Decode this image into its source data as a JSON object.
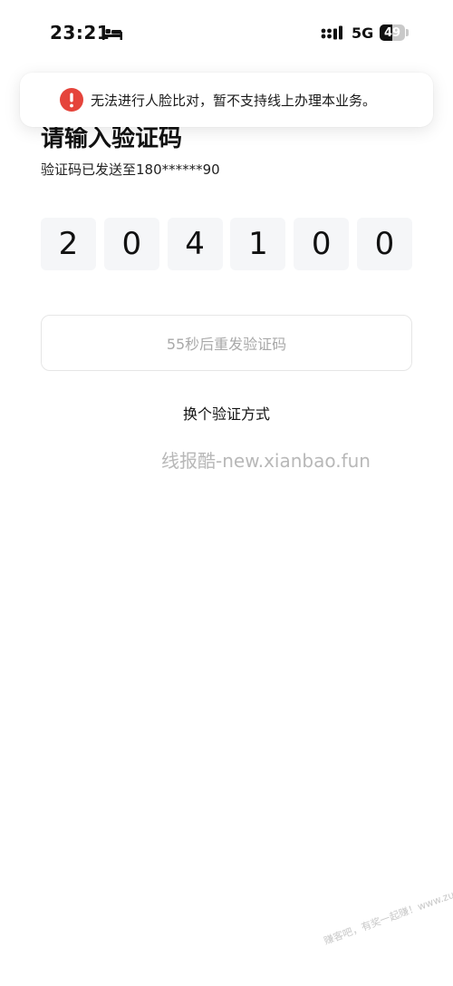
{
  "status_bar": {
    "time": "23:21",
    "network": "5G",
    "battery_level": "49",
    "battery_percent": 49
  },
  "page": {
    "title": "请输入验证码",
    "sent_info": "验证码已发送至180******90"
  },
  "toast": {
    "icon": "error-exclamation-icon",
    "message": "无法进行人脸比对，暂不支持线上办理本业务。",
    "icon_color": "#e5443b"
  },
  "code": {
    "digits": [
      "2",
      "0",
      "4",
      "1",
      "0",
      "0"
    ]
  },
  "resend": {
    "label": "55秒后重发验证码"
  },
  "switch_method": {
    "label": "换个验证方式"
  },
  "watermark": {
    "text": "线报酷-new.xianbao.fun",
    "corner_text": "赚客吧，有奖一起赚！www.zuanke8.com"
  }
}
